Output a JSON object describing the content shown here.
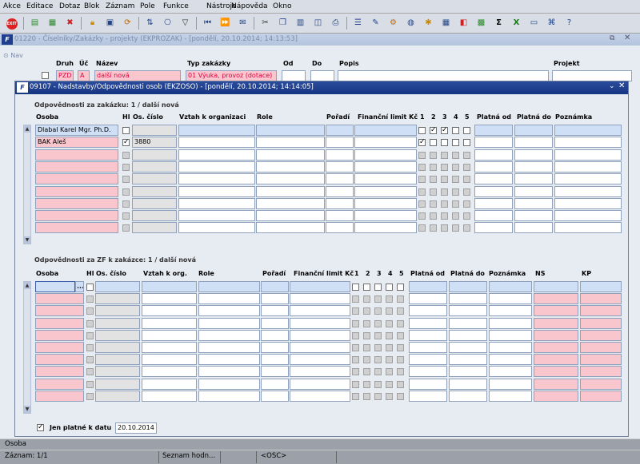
{
  "menu": [
    "Akce",
    "Editace",
    "Dotaz",
    "Blok",
    "Záznam",
    "Pole",
    "Funkce",
    "Nástroje",
    "Nápověda",
    "Okno"
  ],
  "toolbar": {
    "exit_label": "EXIT"
  },
  "bg_window": {
    "title": "01220 - Číselníky/Zakázky - projekty (EKPROZAK) - [pondělí, 20.10.2014; 14:13:53]",
    "nav_label": "Nav",
    "headers": {
      "druh": "Druh",
      "uc": "Úč",
      "nazev": "Název",
      "typ": "Typ zakázky",
      "od": "Od",
      "do": "Do",
      "popis": "Popis",
      "projekt": "Projekt"
    },
    "values": {
      "druh": "PZD",
      "uc": "A",
      "nazev": "další nová",
      "typ": "01 Výuka, provoz (dotace)"
    }
  },
  "dialog": {
    "title": "09107 - Nadstavby/Odpovědnosti osob (EKZOSO) - [pondělí, 20.10.2014; 14:14:05]",
    "section1": {
      "title": "Odpovědnosti za zakázku: 1 / další nová",
      "headers": {
        "osoba": "Osoba",
        "hl": "Hl",
        "os_cislo": "Os. číslo",
        "vztah": "Vztah k organizaci",
        "role": "Role",
        "poradi": "Pořadí",
        "limit": "Finanční limit Kč",
        "c1": "1",
        "c2": "2",
        "c3": "3",
        "c4": "4",
        "c5": "5",
        "platna_od": "Platná od",
        "platna_do": "Platná do",
        "poznamka": "Poznámka"
      },
      "rows": [
        {
          "osoba": "Dlabal Karel Mgr. Ph.D.",
          "hl": false,
          "os_cislo": "",
          "checks": [
            false,
            true,
            true,
            false,
            false
          ]
        },
        {
          "osoba": "BAK Aleš",
          "hl": true,
          "os_cislo": "3880",
          "checks": [
            true,
            false,
            false,
            false,
            false
          ]
        },
        {
          "osoba": "",
          "hl": false,
          "os_cislo": "",
          "checks": []
        },
        {
          "osoba": "",
          "hl": false,
          "os_cislo": "",
          "checks": []
        },
        {
          "osoba": "",
          "hl": false,
          "os_cislo": "",
          "checks": []
        },
        {
          "osoba": "",
          "hl": false,
          "os_cislo": "",
          "checks": []
        },
        {
          "osoba": "",
          "hl": false,
          "os_cislo": "",
          "checks": []
        },
        {
          "osoba": "",
          "hl": false,
          "os_cislo": "",
          "checks": []
        },
        {
          "osoba": "",
          "hl": false,
          "os_cislo": "",
          "checks": []
        }
      ]
    },
    "section2": {
      "title": "Odpovědnosti za ZF k zakázce: 1 / další nová",
      "headers": {
        "osoba": "Osoba",
        "hl": "Hl",
        "os_cislo": "Os. číslo",
        "vztah": "Vztah k org.",
        "role": "Role",
        "poradi": "Pořadí",
        "limit": "Finanční limit Kč",
        "c1": "1",
        "c2": "2",
        "c3": "3",
        "c4": "4",
        "c5": "5",
        "platna_od": "Platná od",
        "platna_do": "Platná do",
        "poznamka": "Poznámka",
        "ns": "NS",
        "kp": "KP"
      },
      "lov_button": "...",
      "row_count": 10
    },
    "filter": {
      "label": "Jen platné k datu",
      "checked": true,
      "date": "20.10.2014"
    }
  },
  "status": {
    "field_name": "Osoba",
    "record": "Záznam: 1/1",
    "list": "Seznam hodn...",
    "mode": "<OSC>"
  }
}
